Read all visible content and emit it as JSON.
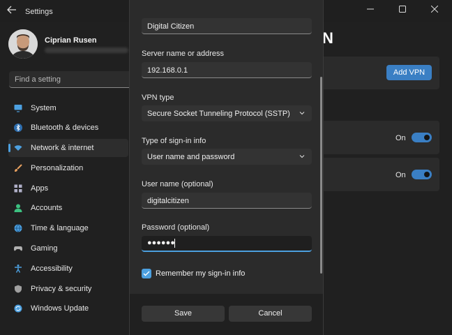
{
  "window": {
    "title": "Settings",
    "back_icon": "back-arrow-icon",
    "controls": [
      "minimize-icon",
      "maximize-icon",
      "close-icon"
    ]
  },
  "profile": {
    "name": "Ciprian Rusen"
  },
  "search": {
    "placeholder": "Find a setting"
  },
  "sidebar": {
    "items": [
      {
        "label": "System",
        "icon": "monitor-icon",
        "color": "#4ca0e0"
      },
      {
        "label": "Bluetooth & devices",
        "icon": "bluetooth-icon",
        "color": "#4ca0e0"
      },
      {
        "label": "Network & internet",
        "icon": "wifi-icon",
        "color": "#4ca0e0",
        "selected": true
      },
      {
        "label": "Personalization",
        "icon": "brush-icon",
        "color": "#e8a060"
      },
      {
        "label": "Apps",
        "icon": "apps-icon",
        "color": "#b0b0c8"
      },
      {
        "label": "Accounts",
        "icon": "person-icon",
        "color": "#3cc080"
      },
      {
        "label": "Time & language",
        "icon": "globe-clock-icon",
        "color": "#4ca0e0"
      },
      {
        "label": "Gaming",
        "icon": "gamepad-icon",
        "color": "#b0b0b0"
      },
      {
        "label": "Accessibility",
        "icon": "accessibility-icon",
        "color": "#4ca0e0"
      },
      {
        "label": "Privacy & security",
        "icon": "shield-icon",
        "color": "#a0a0a0"
      },
      {
        "label": "Windows Update",
        "icon": "update-icon",
        "color": "#4ca0e0"
      }
    ]
  },
  "background": {
    "page_title_fragment": "N",
    "add_vpn_label": "Add VPN",
    "toggles": [
      {
        "label": "On",
        "state": "on"
      },
      {
        "label": "On",
        "state": "on"
      }
    ]
  },
  "dialog": {
    "connection_name_value": "Digital Citizen",
    "server_label": "Server name or address",
    "server_value": "192.168.0.1",
    "vpn_type_label": "VPN type",
    "vpn_type_value": "Secure Socket Tunneling Protocol (SSTP)",
    "signin_type_label": "Type of sign-in info",
    "signin_type_value": "User name and password",
    "username_label": "User name (optional)",
    "username_value": "digitalcitizen",
    "password_label": "Password (optional)",
    "password_masked": "●●●●●●",
    "remember_label": "Remember my sign-in info",
    "remember_checked": true,
    "save_label": "Save",
    "cancel_label": "Cancel"
  },
  "colors": {
    "accent": "#4ca0e0",
    "button_accent": "#3a7fc4"
  }
}
